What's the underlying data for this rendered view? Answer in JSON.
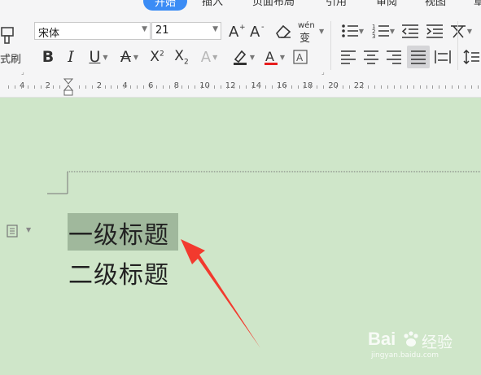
{
  "tabs": [
    {
      "label": "开始",
      "active": true
    },
    {
      "label": "插入"
    },
    {
      "label": "页面布局"
    },
    {
      "label": "引用"
    },
    {
      "label": "审阅"
    },
    {
      "label": "视图"
    },
    {
      "label": "章"
    }
  ],
  "toolbar": {
    "format_painter_label": "式刷",
    "font_name": "宋体",
    "font_size": "21",
    "pinyin_label": "wén",
    "pinyin_char": "变"
  },
  "ruler": {
    "numbers": [
      "4",
      "2",
      "2",
      "4",
      "6",
      "8",
      "10",
      "12",
      "14",
      "16",
      "18",
      "20",
      "22"
    ]
  },
  "document": {
    "line1": "一级标题",
    "line2": "二级标题"
  },
  "watermark": {
    "brand": "Bai",
    "brand2": "经验",
    "url": "jingyan.baidu.com"
  },
  "colors": {
    "accent": "#3b8cf5",
    "page": "#cfe6c9",
    "arrow": "#f23a2e",
    "font_color_bar": "#e81e1e"
  }
}
